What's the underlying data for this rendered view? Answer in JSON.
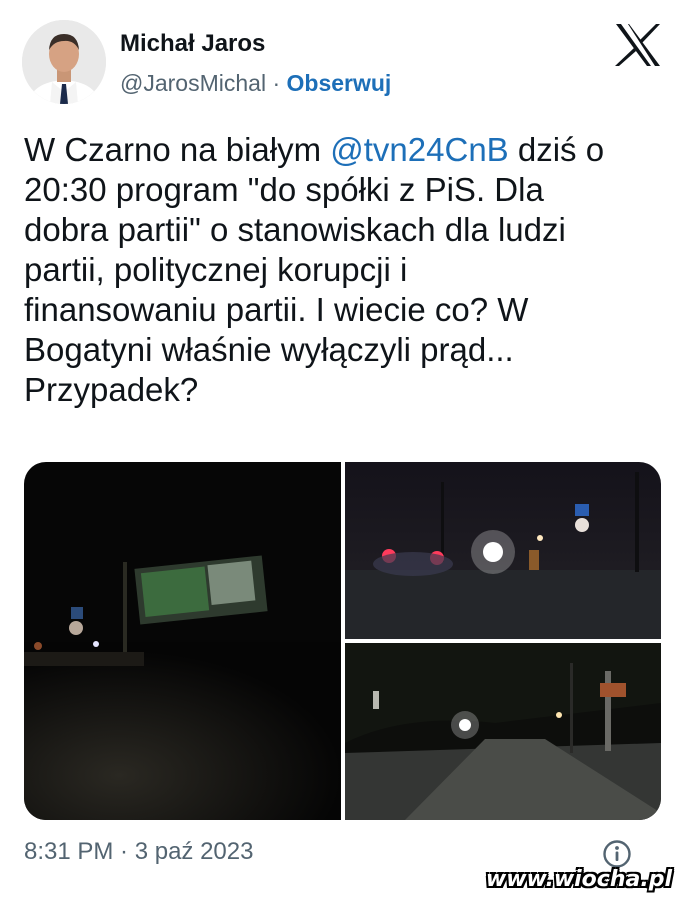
{
  "author": {
    "name": "Michał Jaros",
    "handle": "@JarosMichal",
    "separator": "·",
    "follow_label": "Obserwuj"
  },
  "platform_icon": "x-logo-icon",
  "tweet": {
    "text_before": "W Czarno na białym ",
    "mention": "@tvn24CnB",
    "text_after": " dziś o\n20:30 program \"do spółki z PiS. Dla\ndobra partii\" o stanowiskach dla ludzi\npartii, politycznej korupcji i\nfinansowaniu partii. I wiecie co? W\nBogatyni właśnie wyłączyli prąd...\nPrzypadek?"
  },
  "timestamp": "8:31 PM · 3 paź 2023",
  "info_icon": "info-icon",
  "watermark": "www.wiocha.pl",
  "colors": {
    "link": "#1d6fb8",
    "secondary_text": "#536471",
    "primary_text": "#0f1419"
  }
}
